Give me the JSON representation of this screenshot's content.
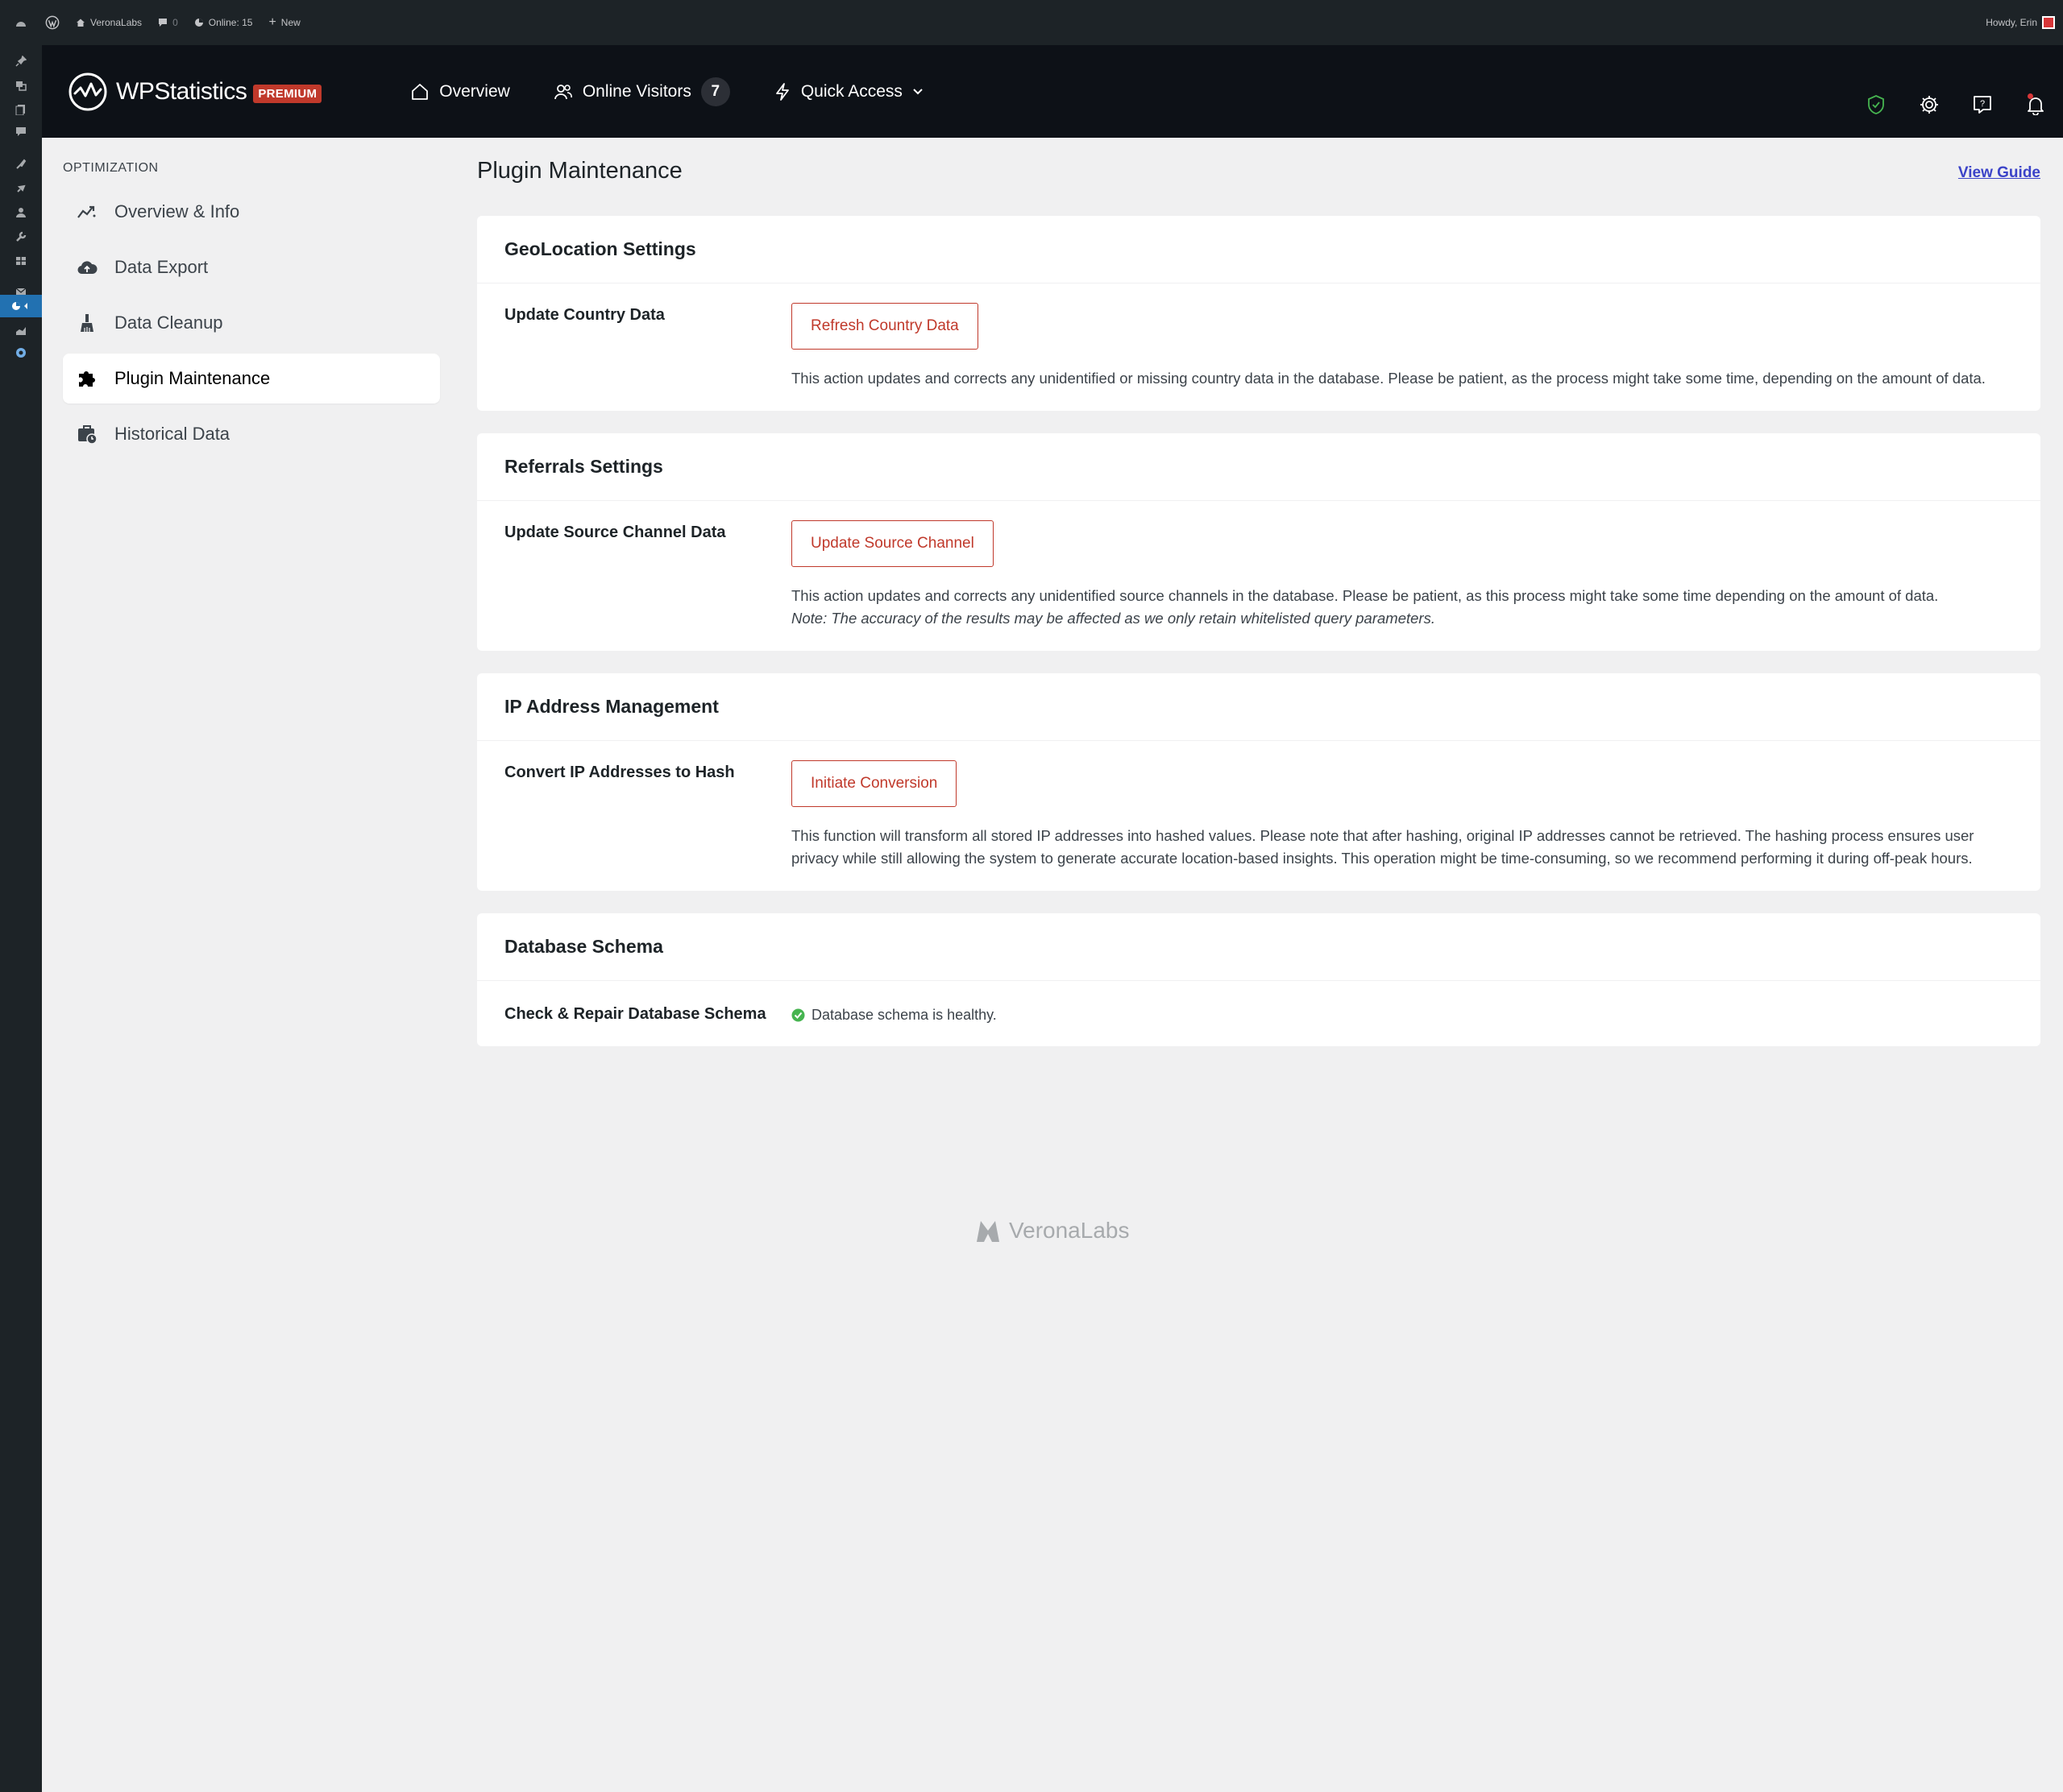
{
  "admin_bar": {
    "site_name": "VeronaLabs",
    "comments_count": "0",
    "online": "Online: 15",
    "new_label": "New",
    "howdy": "Howdy, Erin"
  },
  "header": {
    "brand": "WPStatistics",
    "badge": "PREMIUM",
    "nav": {
      "overview": "Overview",
      "online_visitors": "Online Visitors",
      "online_visitors_count": "7",
      "quick_access": "Quick Access"
    }
  },
  "sidebar": {
    "heading": "OPTIMIZATION",
    "items": [
      {
        "label": "Overview & Info"
      },
      {
        "label": "Data Export"
      },
      {
        "label": "Data Cleanup"
      },
      {
        "label": "Plugin Maintenance"
      },
      {
        "label": "Historical Data"
      }
    ]
  },
  "main": {
    "title": "Plugin Maintenance",
    "view_guide": "View Guide",
    "sections": {
      "geo": {
        "title": "GeoLocation Settings",
        "label": "Update Country Data",
        "button": "Refresh Country Data",
        "description": "This action updates and corrects any unidentified or missing country data in the database. Please be patient, as the process might take some time, depending on the amount of data."
      },
      "referrals": {
        "title": "Referrals Settings",
        "label": "Update Source Channel Data",
        "button": "Update Source Channel",
        "description": "This action updates and corrects any unidentified source channels in the database. Please be patient, as this process might take some time depending on the amount of data.",
        "note": "Note: The accuracy of the results may be affected as we only retain whitelisted query parameters."
      },
      "ip": {
        "title": "IP Address Management",
        "label": "Convert IP Addresses to Hash",
        "button": "Initiate Conversion",
        "description": "This function will transform all stored IP addresses into hashed values. Please note that after hashing, original IP addresses cannot be retrieved. The hashing process ensures user privacy while still allowing the system to generate accurate location-based insights. This operation might be time-consuming, so we recommend performing it during off-peak hours."
      },
      "db": {
        "title": "Database Schema",
        "label": "Check & Repair Database Schema",
        "status": "Database schema is healthy."
      }
    }
  },
  "footer": {
    "brand": "VeronaLabs"
  },
  "colors": {
    "accent_red": "#c0392b",
    "link_blue": "#3b43c8",
    "success_green": "#46b450",
    "wp_blue": "#2271b1"
  }
}
